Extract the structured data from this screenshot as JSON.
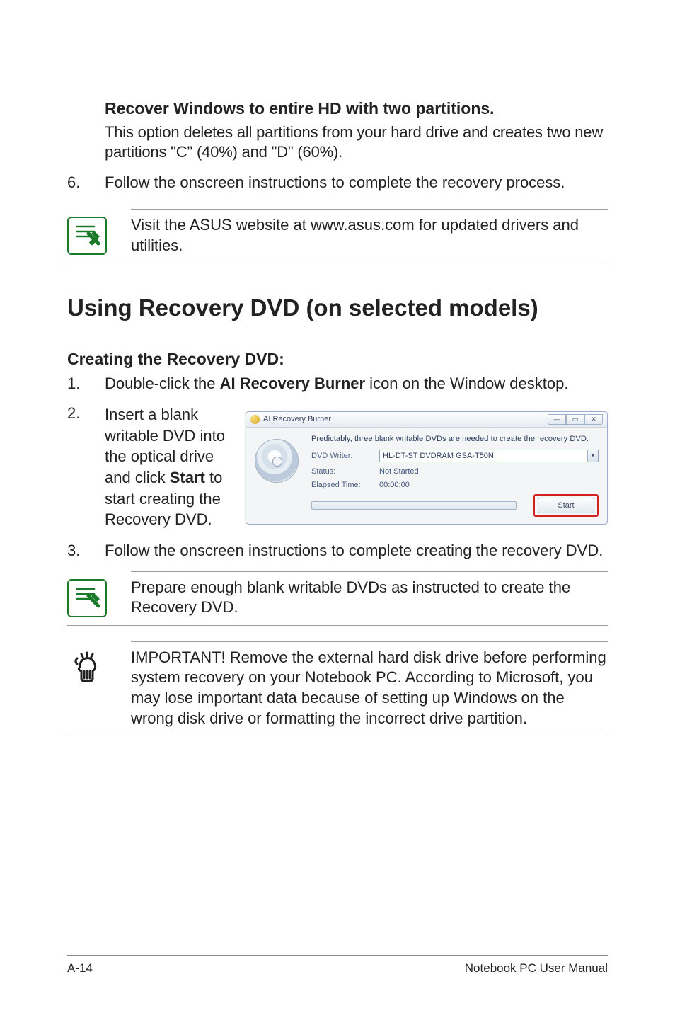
{
  "opt_heading": "Recover Windows to entire HD with two partitions.",
  "opt_para": "This option deletes all partitions from your hard drive and creates two new partitions \"C\" (40%) and \"D\" (60%).",
  "step6_num": "6.",
  "step6_text": "Follow the onscreen instructions to complete the recovery process.",
  "note1": "Visit the ASUS website at www.asus.com for updated drivers and utilities.",
  "section_h1": "Using Recovery DVD (on selected models)",
  "sub_h2": "Creating the Recovery DVD:",
  "step1_num": "1.",
  "step1_pre": "Double-click the ",
  "step1_bold": "AI Recovery Burner",
  "step1_post": " icon on the Window desktop.",
  "step2_num": "2.",
  "step2_pre": "Insert a blank writable DVD into the optical drive and click ",
  "step2_bold": "Start",
  "step2_post": " to start creating the Recovery DVD.",
  "step3_num": "3.",
  "step3_text": "Follow the onscreen instructions to complete creating the recovery DVD.",
  "note2": "Prepare enough blank writable DVDs as instructed to create the Recovery DVD.",
  "note3": "IMPORTANT! Remove the external hard disk drive before performing system recovery on your Notebook PC. According to Microsoft, you may lose important data because of setting up Windows on the wrong disk drive or formatting the incorrect drive partition.",
  "burner": {
    "title": "AI Recovery Burner",
    "msg": "Predictably, three blank writable DVDs are needed to create the recovery DVD.",
    "lbl_writer": "DVD Writer:",
    "val_writer": "HL-DT-ST DVDRAM GSA-T50N",
    "lbl_status": "Status:",
    "val_status": "Not Started",
    "lbl_elapsed": "Elapsed Time:",
    "val_elapsed": "00:00:00",
    "btn_start": "Start"
  },
  "footer_left": "A-14",
  "footer_right": "Notebook PC User Manual"
}
